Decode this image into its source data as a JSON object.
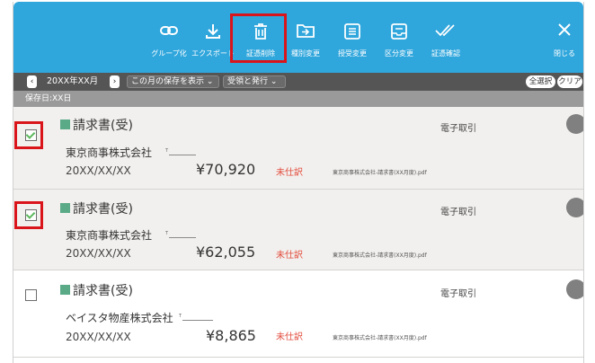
{
  "toolbar": {
    "buttons": [
      {
        "label": "グループ化",
        "icon": "link-icon"
      },
      {
        "label": "エクスポート",
        "icon": "download-icon"
      },
      {
        "label": "証憑削除",
        "icon": "trash-icon"
      },
      {
        "label": "種別変更",
        "icon": "folder-arrow-icon"
      },
      {
        "label": "授受変更",
        "icon": "list-icon"
      },
      {
        "label": "区分変更",
        "icon": "inbox-icon"
      },
      {
        "label": "証憑確認",
        "icon": "double-check-icon"
      }
    ],
    "close_label": "閉じる"
  },
  "nav": {
    "period": "20XX年XX月",
    "view_select": "この月の保存を表示",
    "type_select": "受領と発行",
    "select_all": "全選択",
    "clear": "クリア"
  },
  "date_header": "保存日:XX日",
  "items": [
    {
      "doc_type": "請求書(受)",
      "trade_type": "電子取引",
      "company": "東京商事株式会社",
      "small": "T",
      "date": "20XX/XX/XX",
      "amount": "¥70,920",
      "status": "未仕訳",
      "file": "東京商事株式会社-請求書(XX月度).pdf",
      "checked": true
    },
    {
      "doc_type": "請求書(受)",
      "trade_type": "電子取引",
      "company": "東京商事株式会社",
      "small": "T",
      "date": "20XX/XX/XX",
      "amount": "¥62,055",
      "status": "未仕訳",
      "file": "東京商事株式会社-請求書(XX月度).pdf",
      "checked": true
    },
    {
      "doc_type": "請求書(受)",
      "trade_type": "電子取引",
      "company": "ベイスタ物産株式会社",
      "small": "T",
      "date": "20XX/XX/XX",
      "amount": "¥8,865",
      "status": "未仕訳",
      "file": "東京商事株式会社-請求書(XX月度).pdf",
      "checked": false
    }
  ],
  "colors": {
    "toolbar": "#2fa6dc",
    "highlight": "#d9141b",
    "status": "#e24b3c",
    "doc_square": "#5aaa87"
  }
}
